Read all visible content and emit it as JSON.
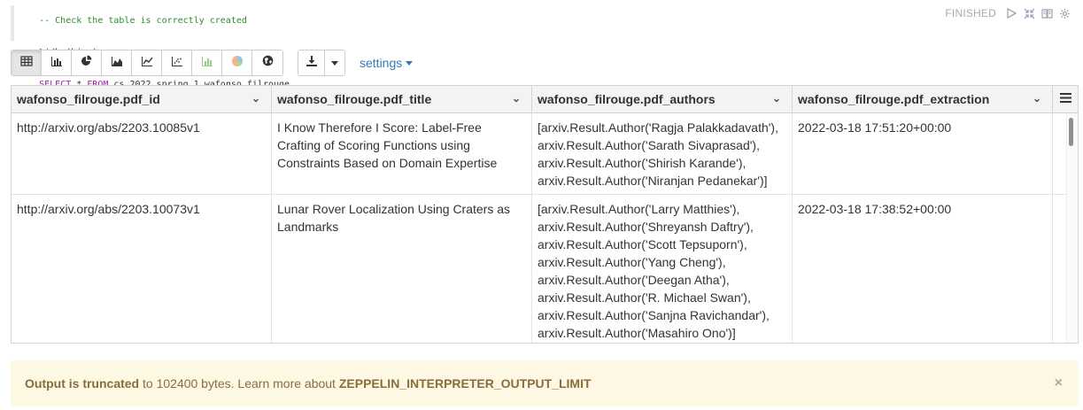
{
  "editor": {
    "lines": [
      {
        "parts": [
          {
            "cls": "c-comment",
            "text": "-- Check the table is correctly created"
          }
        ]
      },
      {
        "parts": [
          {
            "cls": "c-comment",
            "text": "%"
          },
          {
            "cls": "c-plain",
            "text": "jdbc(hive)"
          }
        ]
      },
      {
        "parts": [
          {
            "cls": "c-kw",
            "text": "SELECT"
          },
          {
            "cls": "c-plain",
            "text": " * "
          },
          {
            "cls": "c-kw",
            "text": "FROM"
          },
          {
            "cls": "c-plain",
            "text": " cs_2022_spring_1.wafonso_filrouge"
          }
        ]
      }
    ]
  },
  "paragraph": {
    "status": "FINISHED",
    "icons": [
      "run-icon",
      "collapse-icon",
      "book-icon",
      "gear-icon"
    ]
  },
  "toolbar": {
    "viz_buttons": [
      {
        "name": "table-icon",
        "active": true
      },
      {
        "name": "bar-chart-icon",
        "active": false
      },
      {
        "name": "pie-chart-icon",
        "active": false
      },
      {
        "name": "area-chart-icon",
        "active": false
      },
      {
        "name": "line-chart-icon",
        "active": false
      },
      {
        "name": "scatter-chart-icon",
        "active": false
      },
      {
        "name": "mini-bar-chart-icon",
        "active": false
      },
      {
        "name": "pie-colored-icon",
        "active": false
      },
      {
        "name": "globe-icon",
        "active": false
      }
    ],
    "settings_label": "settings"
  },
  "table": {
    "columns": [
      "wafonso_filrouge.pdf_id",
      "wafonso_filrouge.pdf_title",
      "wafonso_filrouge.pdf_authors",
      "wafonso_filrouge.pdf_extraction"
    ],
    "rows": [
      {
        "id": "http://arxiv.org/abs/2203.10085v1",
        "title": "I Know Therefore I Score: Label-Free Crafting of Scoring Functions using Constraints Based on Domain Expertise",
        "authors": [
          "[arxiv.Result.Author('Ragja Palakkadavath'),",
          "arxiv.Result.Author('Sarath Sivaprasad'),",
          "arxiv.Result.Author('Shirish Karande'),",
          "arxiv.Result.Author('Niranjan Pedanekar')]"
        ],
        "extraction": "2022-03-18 17:51:20+00:00"
      },
      {
        "id": "http://arxiv.org/abs/2203.10073v1",
        "title": "Lunar Rover Localization Using Craters as Landmarks",
        "authors": [
          "[arxiv.Result.Author('Larry Matthies'),",
          "arxiv.Result.Author('Shreyansh Daftry'),",
          "arxiv.Result.Author('Scott Tepsuporn'),",
          "arxiv.Result.Author('Yang Cheng'),",
          "arxiv.Result.Author('Deegan Atha'),",
          "arxiv.Result.Author('R. Michael Swan'),",
          "arxiv.Result.Author('Sanjna Ravichandar'),",
          "arxiv.Result.Author('Masahiro Ono')]"
        ],
        "extraction": "2022-03-18 17:38:52+00:00"
      }
    ]
  },
  "alert": {
    "bold_text": "Output is truncated",
    "middle_text": " to 102400 bytes. Learn more about ",
    "link_text": "ZEPPELIN_INTERPRETER_OUTPUT_LIMIT",
    "close": "×"
  }
}
